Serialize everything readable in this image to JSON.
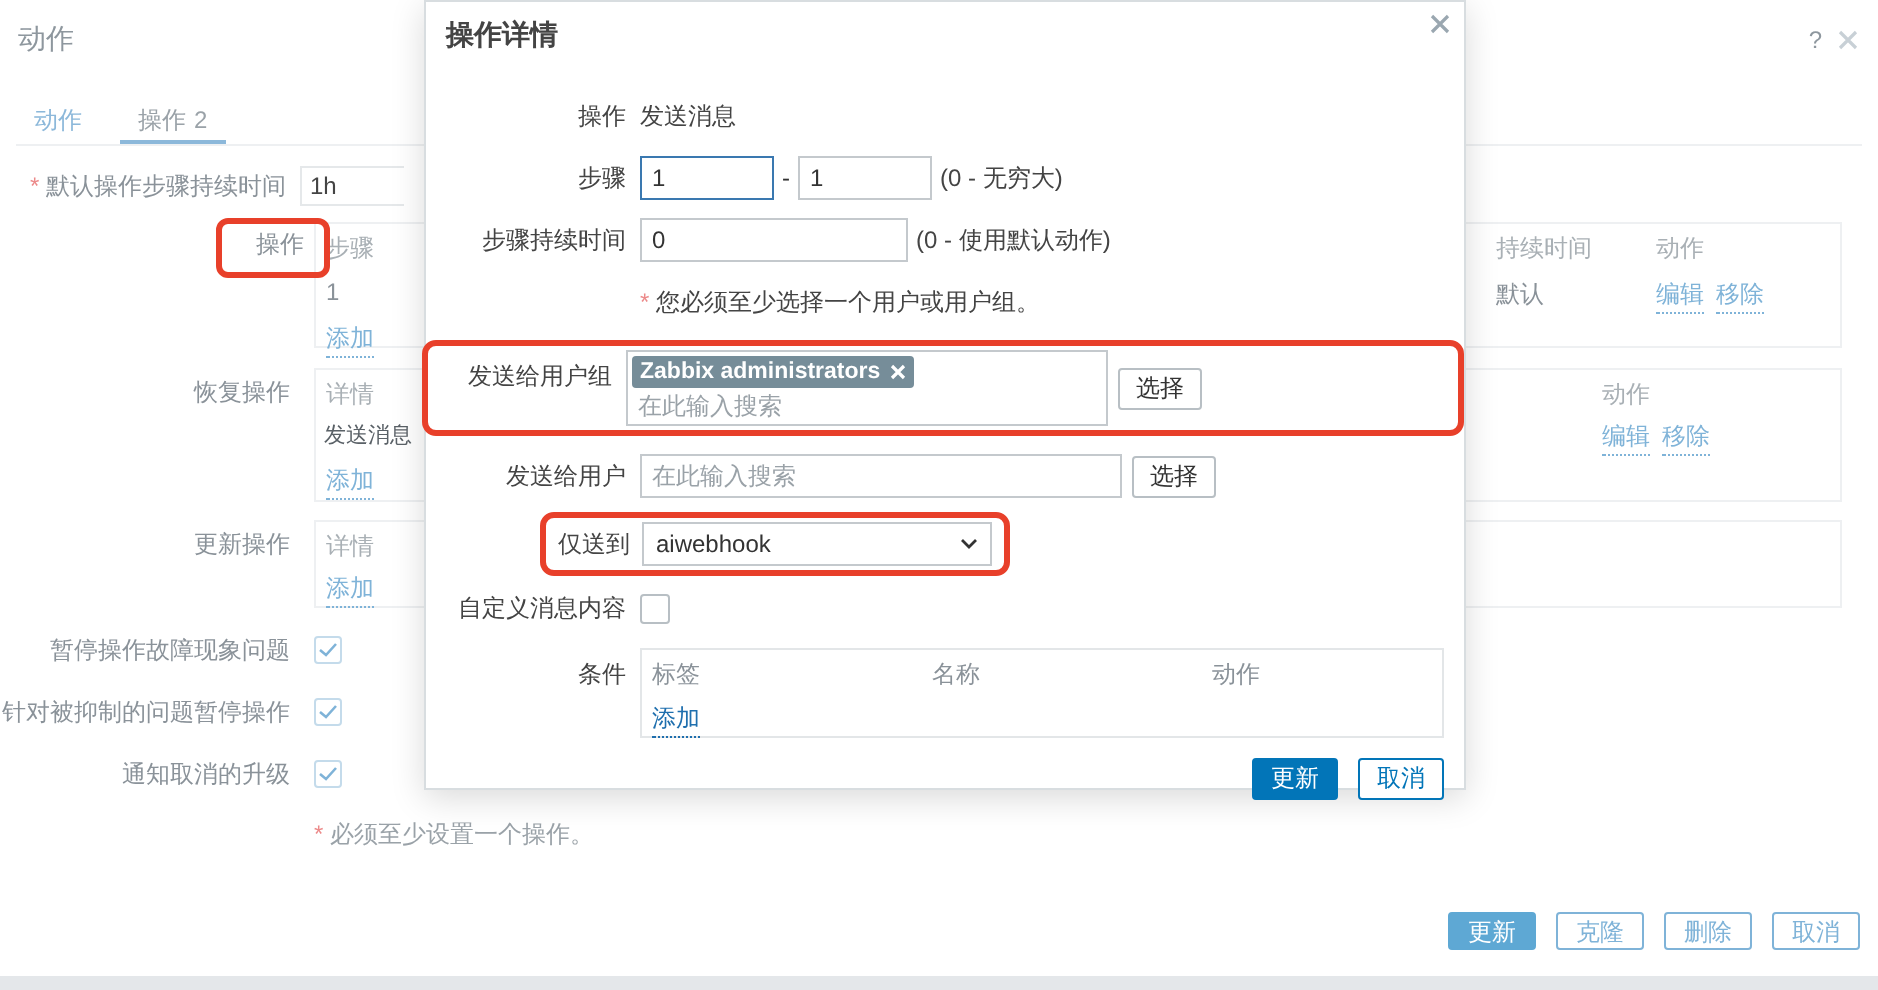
{
  "dialog": {
    "title": "动作",
    "help": "?"
  },
  "tabs": [
    {
      "label": "动作",
      "selected": false
    },
    {
      "label": "操作",
      "count": "2",
      "selected": true
    }
  ],
  "form": {
    "default_step_duration": {
      "marker": "*",
      "label": "默认操作步骤持续时间",
      "value": "1h"
    },
    "operations": {
      "label": "操作",
      "highlighted": true,
      "columns": [
        "步骤",
        "持续时间",
        "动作"
      ],
      "rows": [
        {
          "step": "1",
          "duration": "默认",
          "actions": [
            "编辑",
            "移除"
          ]
        }
      ],
      "add": "添加"
    },
    "recovery_operations": {
      "label": "恢复操作",
      "columns": [
        "详情",
        "动作"
      ],
      "rows": [
        {
          "details": "发送消息",
          "actions": [
            "编辑",
            "移除"
          ]
        }
      ],
      "add": "添加"
    },
    "update_operations": {
      "label": "更新操作",
      "columns": [
        "详情"
      ],
      "add": "添加"
    },
    "checkboxes": [
      {
        "label": "暂停操作故障现象问题",
        "checked": true
      },
      {
        "label": "针对被抑制的问题暂停操作",
        "checked": true
      },
      {
        "label": "通知取消的升级",
        "checked": true
      }
    ],
    "note": {
      "marker": "*",
      "text": "必须至少设置一个操作。"
    }
  },
  "buttons": [
    {
      "label": "更新",
      "primary": true
    },
    {
      "label": "克隆",
      "primary": false
    },
    {
      "label": "删除",
      "primary": false
    },
    {
      "label": "取消",
      "primary": false
    }
  ],
  "modal": {
    "title": "操作详情",
    "operation": {
      "label": "操作",
      "value": "发送消息"
    },
    "steps": {
      "label": "步骤",
      "from": "1",
      "separator": "-",
      "to": "1",
      "hint": "(0 - 无穷大)"
    },
    "step_duration": {
      "label": "步骤持续时间",
      "value": "0",
      "hint": "(0 - 使用默认动作)"
    },
    "note": {
      "marker": "*",
      "text": "您必须至少选择一个用户或用户组。"
    },
    "user_groups": {
      "label": "发送给用户组",
      "highlighted": true,
      "tags": [
        "Zabbix administrators"
      ],
      "placeholder": "在此输入搜索",
      "button": "选择"
    },
    "users": {
      "label": "发送给用户",
      "placeholder": "在此输入搜索",
      "button": "选择"
    },
    "send_only_to": {
      "label": "仅送到",
      "highlighted": true,
      "value": "aiwebhook"
    },
    "custom_message": {
      "label": "自定义消息内容",
      "checked": false
    },
    "conditions": {
      "label": "条件",
      "columns": [
        "标签",
        "名称",
        "动作"
      ],
      "add": "添加"
    },
    "buttons": [
      {
        "label": "更新",
        "primary": true
      },
      {
        "label": "取消",
        "primary": false
      }
    ]
  }
}
